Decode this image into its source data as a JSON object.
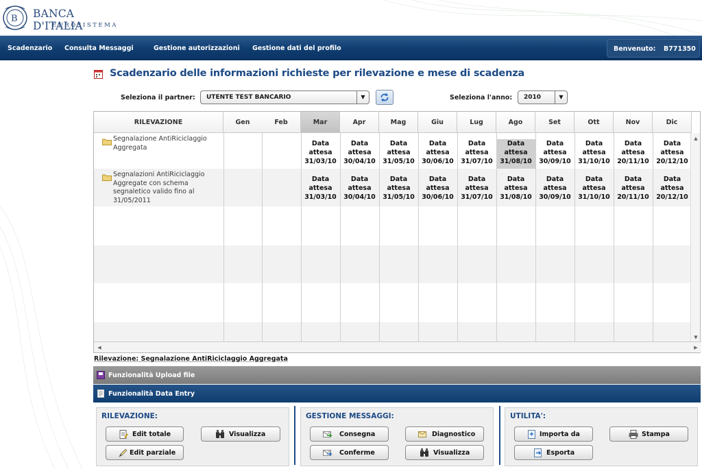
{
  "brand": {
    "name": "BANCA D'ITALIA",
    "subtitle": "EUROSISTEMA",
    "seal_text": "B"
  },
  "nav": {
    "items": [
      "Scadenzario",
      "Consulta Messaggi",
      "Gestione autorizzazioni",
      "Gestione dati del profilo"
    ],
    "welcome_label": "Benvenuto:",
    "welcome_user": "B771350"
  },
  "page": {
    "title": "Scadenzario delle informazioni richieste per rilevazione e mese di scadenza"
  },
  "filters": {
    "partner_label": "Seleziona il partner:",
    "partner_value": "UTENTE TEST BANCARIO",
    "year_label": "Seleziona l'anno:",
    "year_value": "2010"
  },
  "grid": {
    "first_header": "RILEVAZIONE",
    "months": [
      "Gen",
      "Feb",
      "Mar",
      "Apr",
      "Mag",
      "Giu",
      "Lug",
      "Ago",
      "Set",
      "Ott",
      "Nov",
      "Dic"
    ],
    "selected_month": "Mar",
    "rows": [
      {
        "label_lines": [
          "Segnalazione AntiRiciclaggio",
          "Aggregata"
        ],
        "cells": [
          "",
          "",
          "Data|attesa|31/03/10",
          "Data|attesa|30/04/10",
          "Data|attesa|31/05/10",
          "Data|attesa|30/06/10",
          "Data|attesa|31/07/10",
          "Data|attesa|31/08/10",
          "Data|attesa|30/09/10",
          "Data|attesa|31/10/10",
          "Data|attesa|20/11/10",
          "Data|attesa|20/12/10"
        ],
        "highlight_index": 7
      },
      {
        "label_lines": [
          "Segnalazioni AntiRiciclaggio",
          "Aggregate con schema",
          "segnaletico valido fino al",
          "31/05/2011"
        ],
        "cells": [
          "",
          "",
          "Data|attesa|31/03/10",
          "Data|attesa|30/04/10",
          "Data|attesa|31/05/10",
          "Data|attesa|30/06/10",
          "Data|attesa|31/07/10",
          "Data|attesa|31/08/10",
          "Data|attesa|30/09/10",
          "Data|attesa|31/10/10",
          "Data|attesa|20/11/10",
          "Data|attesa|20/12/10"
        ],
        "highlight_index": -1
      }
    ]
  },
  "selection_info": "Rilevazione: Segnalazione AntiRiciclaggio Aggregata",
  "accordion": {
    "upload": "Funzionalità Upload file",
    "data_entry": "Funzionalità Data Entry"
  },
  "panels": {
    "rilevazione": {
      "title": "RILEVAZIONE:",
      "edit_totale": "Edit totale",
      "visualizza": "Visualizza",
      "edit_parziale": "Edit parziale"
    },
    "messaggi": {
      "title": "GESTIONE MESSAGGI:",
      "consegna": "Consegna",
      "diagnostico": "Diagnostico",
      "conferme": "Conferme",
      "visualizza": "Visualizza"
    },
    "utilita": {
      "title": "UTILITA':",
      "importa": "Importa da",
      "stampa": "Stampa",
      "esporta": "Esporta"
    }
  },
  "colors": {
    "nav": "#0f3d70",
    "title": "#1d4a85",
    "highlight": "#cfcfcf"
  }
}
